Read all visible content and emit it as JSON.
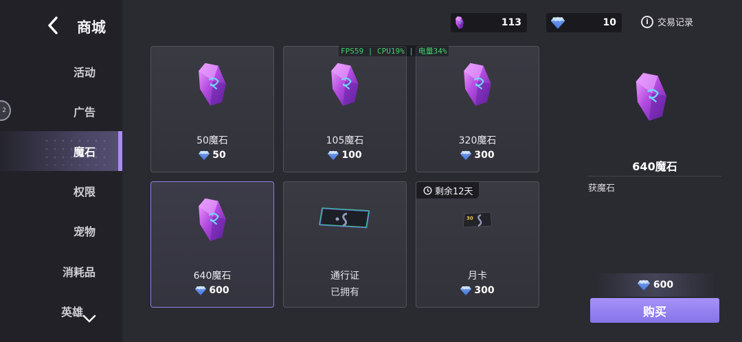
{
  "header": {
    "title": "商城"
  },
  "sidebar": {
    "items": [
      {
        "label": "活动"
      },
      {
        "label": "广告"
      },
      {
        "label": "魔石"
      },
      {
        "label": "权限"
      },
      {
        "label": "宠物"
      },
      {
        "label": "消耗品"
      },
      {
        "label": "英雄"
      }
    ],
    "bubble_text": "2"
  },
  "currencies": {
    "magic_stone": {
      "value": "113"
    },
    "diamond": {
      "value": "10"
    }
  },
  "trade_record_label": "交易记录",
  "perf_overlay": "FPS59 | CPU19% | 电量34%",
  "cards": [
    {
      "name": "50魔石",
      "price": "50"
    },
    {
      "name": "105魔石",
      "price": "100"
    },
    {
      "name": "320魔石",
      "price": "300"
    },
    {
      "name": "640魔石",
      "price": "600"
    },
    {
      "name": "通行证",
      "status": "已拥有"
    },
    {
      "name": "月卡",
      "price": "300",
      "timer": "剩余12天",
      "badge": "30"
    }
  ],
  "detail": {
    "name": "640魔石",
    "description": "获魔石",
    "price": "600",
    "buy_label": "购买"
  },
  "colors": {
    "accent": "#a692f8",
    "gem_purple": "#b44be0",
    "diamond_blue": "#6ea8ff",
    "perf_green": "#3fd26a"
  }
}
